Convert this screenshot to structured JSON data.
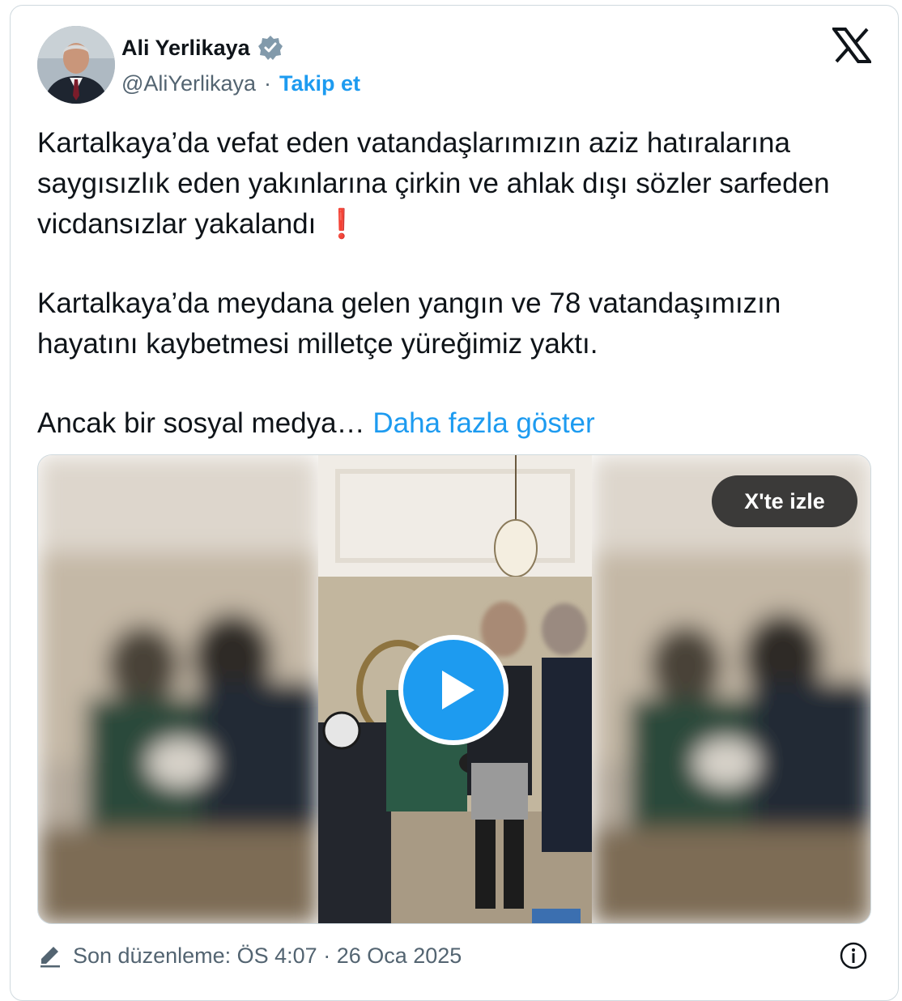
{
  "author": {
    "name": "Ali Yerlikaya",
    "handle": "@AliYerlikaya",
    "separator": "·",
    "follow_label": "Takip et"
  },
  "tweet": {
    "paragraph1": "Kartalkaya’da vefat eden vatandaşlarımızın aziz hatıralarına saygısızlık eden yakınlarına çirkin ve ahlak dışı sözler sarfeden vicdansızlar yakalandı",
    "exclamation": "❗",
    "paragraph2": "Kartalkaya’da meydana gelen yangın ve 78 vatandaşımızın hayatını kaybetmesi milletçe yüreğimiz yaktı.",
    "paragraph3": "Ancak bir sosyal medya…",
    "show_more": "Daha fazla göster"
  },
  "media": {
    "watch_label": "X'te izle"
  },
  "footer": {
    "edited": "Son düzenleme: ÖS 4:07 · 26 Oca 2025"
  },
  "colors": {
    "accent": "#1d9bf0",
    "text": "#0f1419",
    "muted": "#536471",
    "border": "#cfd9de"
  },
  "icons": [
    "verified-badge-icon",
    "x-logo-icon",
    "play-icon",
    "edit-pencil-icon",
    "info-icon"
  ]
}
